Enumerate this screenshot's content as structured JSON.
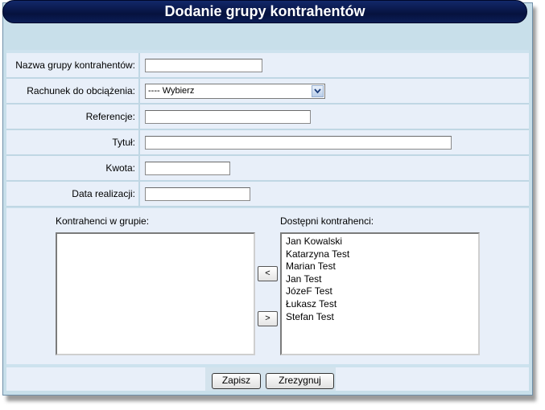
{
  "title": "Dodanie grupy kontrahentów",
  "form": {
    "group_name": {
      "label": "Nazwa grupy kontrahentów:",
      "value": ""
    },
    "account": {
      "label": "Rachunek do obciążenia:",
      "selected": "---- Wybierz"
    },
    "reference": {
      "label": "Referencje:",
      "value": ""
    },
    "subject": {
      "label": "Tytuł:",
      "value": ""
    },
    "amount": {
      "label": "Kwota:",
      "value": ""
    },
    "date": {
      "label": "Data realizacji:",
      "value": ""
    }
  },
  "lists": {
    "in_group_label": "Kontrahenci w grupie:",
    "in_group": [],
    "available_label": "Dostępni kontrahenci:",
    "available": [
      "Jan Kowalski",
      "Katarzyna Test",
      "Marian Test",
      "Jan Test",
      "JózeF Test",
      "Łukasz Test",
      "Stefan Test"
    ],
    "move_left": "<",
    "move_right": ">"
  },
  "buttons": {
    "save": "Zapisz",
    "cancel": "Zrezygnuj"
  }
}
